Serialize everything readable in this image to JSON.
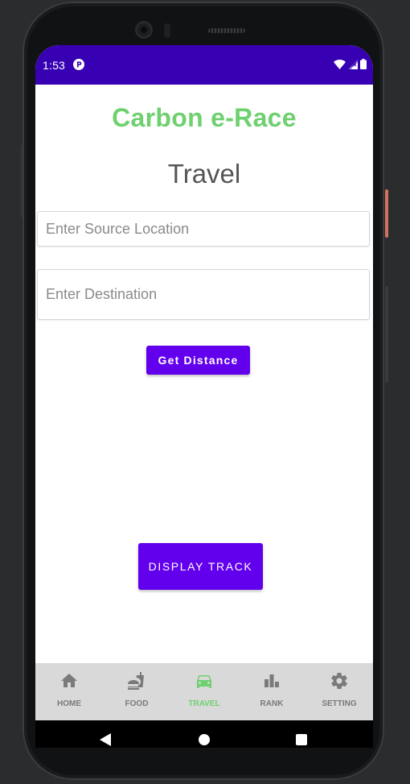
{
  "status_bar": {
    "time": "1:53",
    "icons": [
      "app-notification-icon",
      "wifi-icon",
      "signal-icon",
      "battery-icon"
    ],
    "background": "#3700b3"
  },
  "app": {
    "title": "Carbon e-Race",
    "title_color": "#6ed06f",
    "page_title": "Travel"
  },
  "form": {
    "source_placeholder": "Enter Source Location",
    "source_value": "",
    "destination_placeholder": "Enter Destination",
    "destination_value": "",
    "get_distance_label": "Get Distance",
    "display_track_label": "DISPLAY TRACK",
    "button_color": "#6200ee"
  },
  "bottom_nav": {
    "items": [
      {
        "label": "HOME",
        "icon": "home-icon",
        "active": false
      },
      {
        "label": "FOOD",
        "icon": "food-icon",
        "active": false
      },
      {
        "label": "TRAVEL",
        "icon": "car-icon",
        "active": true
      },
      {
        "label": "RANK",
        "icon": "bar-chart-icon",
        "active": false
      },
      {
        "label": "SETTING",
        "icon": "gear-icon",
        "active": false
      }
    ],
    "active_color": "#6ed06f",
    "inactive_color": "#7a7a7a"
  },
  "system_nav": {
    "icons": [
      "back-icon",
      "home-circle-icon",
      "recents-icon"
    ]
  }
}
